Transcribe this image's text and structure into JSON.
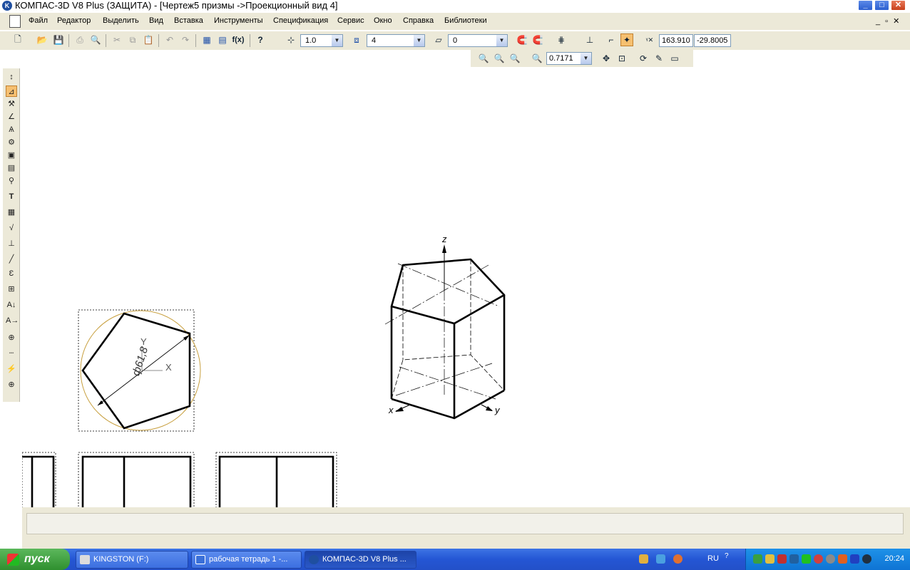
{
  "window": {
    "title": "КОМПАС-3D V8 Plus (ЗАЩИТА) - [Чертеж5 призмы ->Проекционный вид 4]",
    "logo_letter": "K",
    "min_label": "_",
    "max_label": "□",
    "close_label": "✕"
  },
  "menu": {
    "items": [
      "Файл",
      "Редактор",
      "Выделить",
      "Вид",
      "Вставка",
      "Инструменты",
      "Спецификация",
      "Сервис",
      "Окно",
      "Справка",
      "Библиотеки"
    ],
    "doc_controls": "_ ▫ ✕"
  },
  "toolbar": {
    "scale_value": "1.0",
    "layer_value": "4",
    "style_value": "0",
    "fx_label": "f(x)",
    "coord_x": "163.910",
    "coord_y": "-29.8005",
    "zoom_value": "0.7171"
  },
  "drawing": {
    "dimension_label": "ф61,8",
    "axis_x": "X",
    "axis_y": "Y",
    "iso_z": "z",
    "iso_x": "x",
    "iso_y": "y"
  },
  "taskbar": {
    "start_label": "пуск",
    "tasks": [
      "KINGSTON (F:)",
      "рабочая тетрадь 1 -...",
      "КОМПАС-3D V8 Plus ..."
    ],
    "lang": "RU",
    "clock": "20:24"
  }
}
